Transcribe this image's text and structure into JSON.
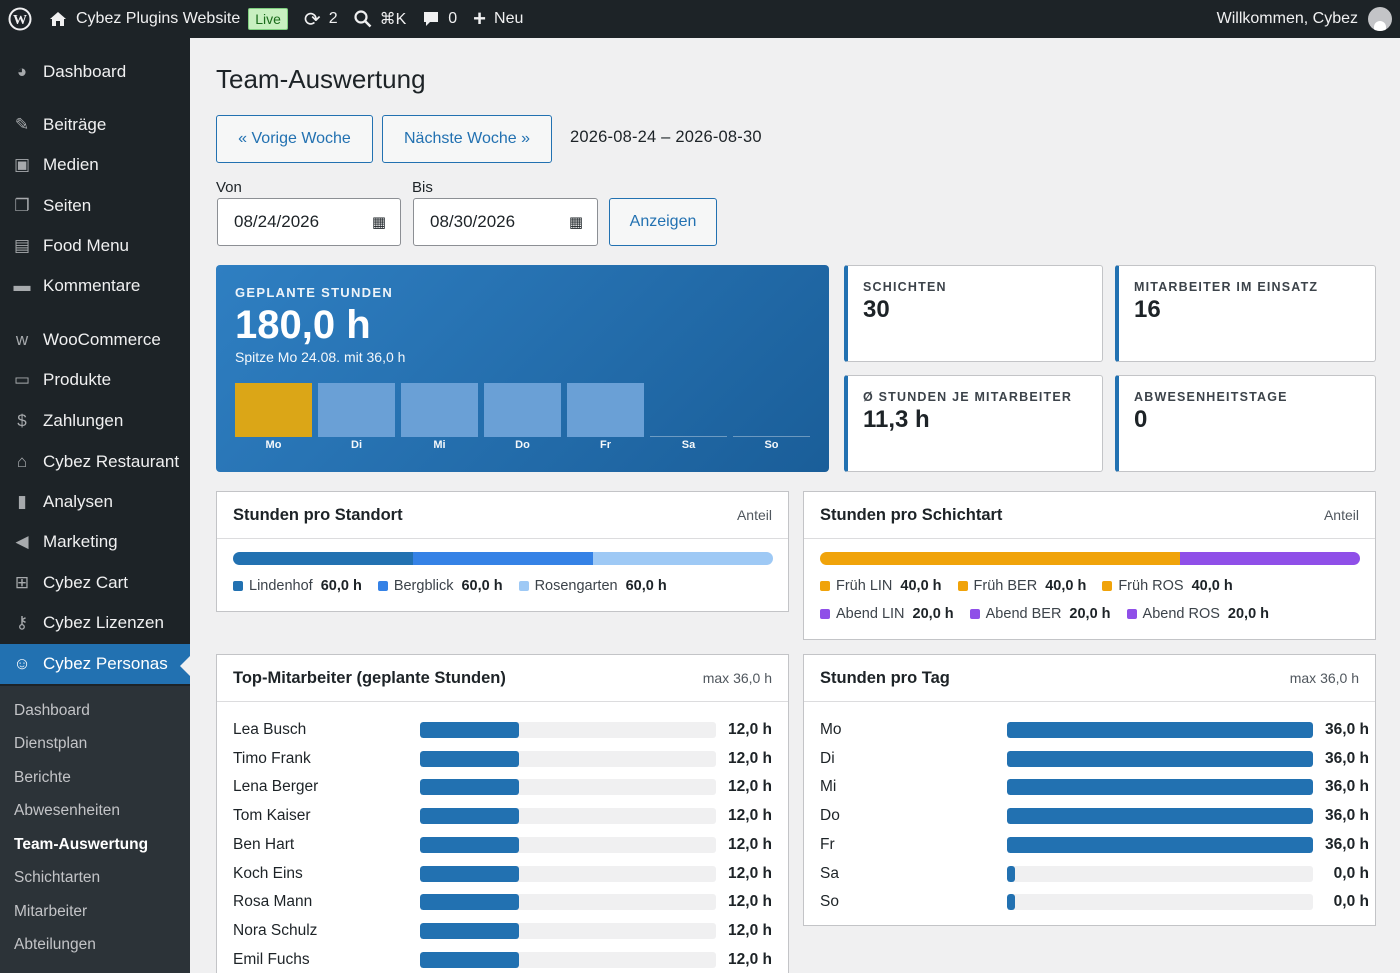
{
  "adminbar": {
    "site": "Cybez Plugins Website",
    "live": "Live",
    "updates": "2",
    "search_shortcut": "⌘K",
    "comments": "0",
    "new": "Neu",
    "welcome": "Willkommen, Cybez"
  },
  "sidebar": {
    "items": [
      {
        "label": "Dashboard",
        "icon": "dashboard-icon"
      },
      {
        "label": "Beiträge",
        "icon": "pin-icon"
      },
      {
        "label": "Medien",
        "icon": "media-icon"
      },
      {
        "label": "Seiten",
        "icon": "pages-icon"
      },
      {
        "label": "Food Menu",
        "icon": "food-icon"
      },
      {
        "label": "Kommentare",
        "icon": "comment-icon"
      },
      {
        "label": "WooCommerce",
        "icon": "woo-icon"
      },
      {
        "label": "Produkte",
        "icon": "products-icon"
      },
      {
        "label": "Zahlungen",
        "icon": "payments-icon"
      },
      {
        "label": "Cybez Restaurant",
        "icon": "store-icon"
      },
      {
        "label": "Analysen",
        "icon": "chart-icon"
      },
      {
        "label": "Marketing",
        "icon": "megaphone-icon"
      },
      {
        "label": "Cybez Cart",
        "icon": "cart-icon"
      },
      {
        "label": "Cybez Lizenzen",
        "icon": "key-icon"
      },
      {
        "label": "Cybez Personas",
        "icon": "people-icon"
      }
    ],
    "submenu": [
      "Dashboard",
      "Dienstplan",
      "Berichte",
      "Abwesenheiten",
      "Team-Auswertung",
      "Schichtarten",
      "Mitarbeiter",
      "Abteilungen"
    ]
  },
  "page": {
    "title": "Team-Auswertung",
    "prev": "« Vorige Woche",
    "next": "Nächste Woche »",
    "range": "2026-08-24 – 2026-08-30",
    "von": "Von",
    "bis": "Bis",
    "von_value": "08/24/2026",
    "bis_value": "08/30/2026",
    "show": "Anzeigen"
  },
  "hero": {
    "caption": "GEPLANTE STUNDEN",
    "total": "180,0 h",
    "peak": "Spitze Mo 24.08. mit 36,0 h",
    "days": [
      {
        "label": "Mo",
        "hours": 36,
        "peak": true
      },
      {
        "label": "Di",
        "hours": 36
      },
      {
        "label": "Mi",
        "hours": 36
      },
      {
        "label": "Do",
        "hours": 36
      },
      {
        "label": "Fr",
        "hours": 36
      },
      {
        "label": "Sa",
        "hours": 0
      },
      {
        "label": "So",
        "hours": 0
      }
    ]
  },
  "stats": [
    {
      "caption": "SCHICHTEN",
      "value": "30"
    },
    {
      "caption": "MITARBEITER IM EINSATZ",
      "value": "16"
    },
    {
      "caption": "Ø STUNDEN JE MITARBEITER",
      "value": "11,3 h"
    },
    {
      "caption": "ABWESENHEITSTAGE",
      "value": "0"
    }
  ],
  "standort": {
    "title": "Stunden pro Standort",
    "note": "Anteil",
    "items": [
      {
        "name": "Lindenhof",
        "value": "60,0 h",
        "hours": 60,
        "color": "#2271b1"
      },
      {
        "name": "Bergblick",
        "value": "60,0 h",
        "hours": 60,
        "color": "#3582e6"
      },
      {
        "name": "Rosengarten",
        "value": "60,0 h",
        "hours": 60,
        "color": "#9ec9f5"
      }
    ]
  },
  "schichtart": {
    "title": "Stunden pro Schichtart",
    "note": "Anteil",
    "items": [
      {
        "name": "Früh LIN",
        "value": "40,0 h",
        "hours": 40,
        "color": "#f0a30a"
      },
      {
        "name": "Früh BER",
        "value": "40,0 h",
        "hours": 40,
        "color": "#f0a30a"
      },
      {
        "name": "Früh ROS",
        "value": "40,0 h",
        "hours": 40,
        "color": "#f0a30a"
      },
      {
        "name": "Abend LIN",
        "value": "20,0 h",
        "hours": 20,
        "color": "#8f4fe8"
      },
      {
        "name": "Abend BER",
        "value": "20,0 h",
        "hours": 20,
        "color": "#8f4fe8"
      },
      {
        "name": "Abend ROS",
        "value": "20,0 h",
        "hours": 20,
        "color": "#8f4fe8"
      }
    ]
  },
  "top": {
    "title": "Top-Mitarbeiter (geplante Stunden)",
    "note": "max 36,0 h",
    "max": 36,
    "rows": [
      {
        "name": "Lea Busch",
        "value": "12,0 h",
        "hours": 12
      },
      {
        "name": "Timo Frank",
        "value": "12,0 h",
        "hours": 12
      },
      {
        "name": "Lena Berger",
        "value": "12,0 h",
        "hours": 12
      },
      {
        "name": "Tom Kaiser",
        "value": "12,0 h",
        "hours": 12
      },
      {
        "name": "Ben Hart",
        "value": "12,0 h",
        "hours": 12
      },
      {
        "name": "Koch Eins",
        "value": "12,0 h",
        "hours": 12
      },
      {
        "name": "Rosa Mann",
        "value": "12,0 h",
        "hours": 12
      },
      {
        "name": "Nora Schulz",
        "value": "12,0 h",
        "hours": 12
      },
      {
        "name": "Emil Fuchs",
        "value": "12,0 h",
        "hours": 12
      }
    ]
  },
  "tag": {
    "title": "Stunden pro Tag",
    "note": "max 36,0 h",
    "max": 36,
    "rows": [
      {
        "name": "Mo",
        "value": "36,0 h",
        "hours": 36
      },
      {
        "name": "Di",
        "value": "36,0 h",
        "hours": 36
      },
      {
        "name": "Mi",
        "value": "36,0 h",
        "hours": 36
      },
      {
        "name": "Do",
        "value": "36,0 h",
        "hours": 36
      },
      {
        "name": "Fr",
        "value": "36,0 h",
        "hours": 36
      },
      {
        "name": "Sa",
        "value": "0,0 h",
        "hours": 0
      },
      {
        "name": "So",
        "value": "0,0 h",
        "hours": 0
      }
    ]
  },
  "colors": {
    "accent": "#2271b1",
    "peak": "#dba617",
    "bar": "#6aa0d6"
  }
}
